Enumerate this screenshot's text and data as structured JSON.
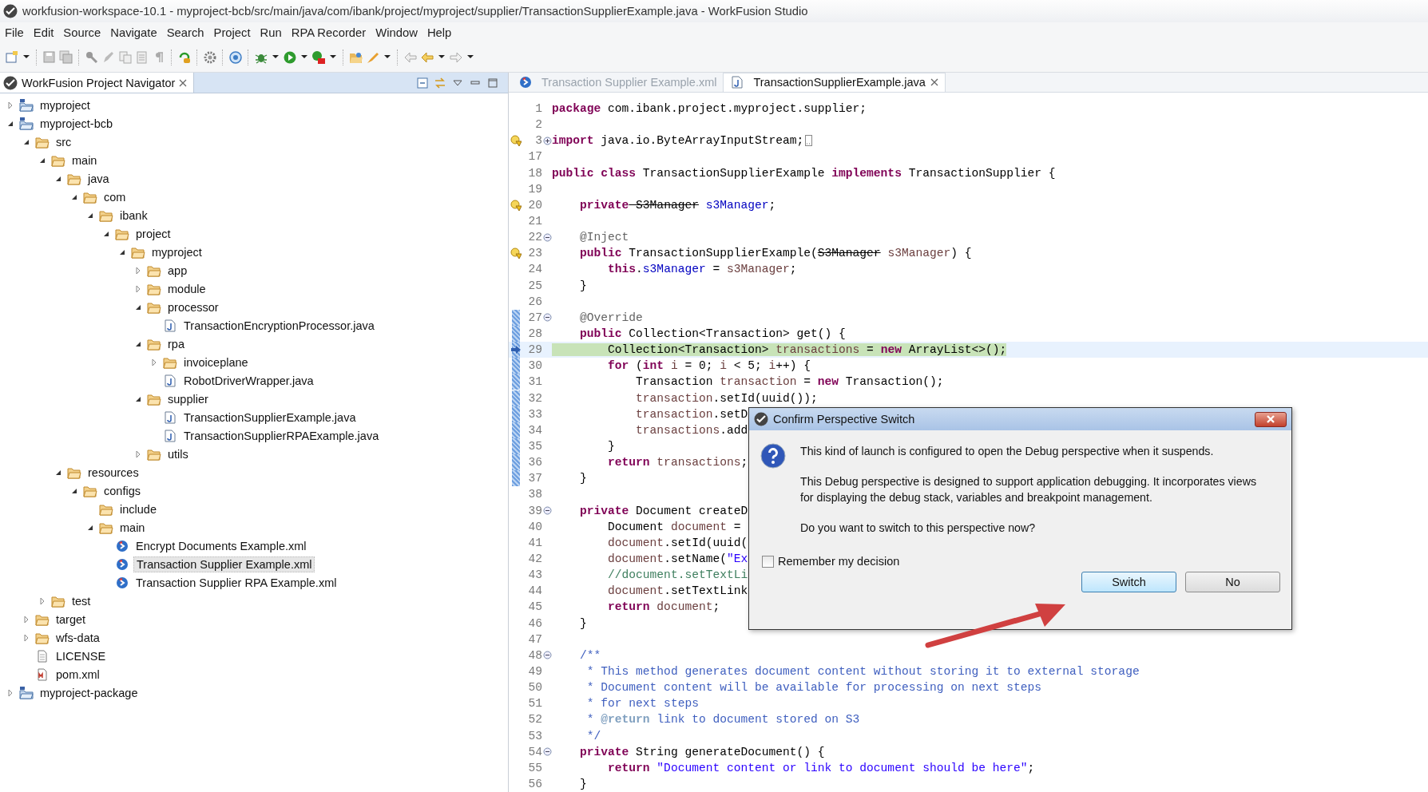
{
  "window": {
    "title": "workfusion-workspace-10.1 - myproject-bcb/src/main/java/com/ibank/project/myproject/supplier/TransactionSupplierExample.java - WorkFusion Studio"
  },
  "menu": [
    "File",
    "Edit",
    "Source",
    "Navigate",
    "Search",
    "Project",
    "Run",
    "RPA Recorder",
    "Window",
    "Help"
  ],
  "navigator": {
    "title": "WorkFusion Project Navigator",
    "tree": [
      {
        "label": "myproject",
        "kind": "project",
        "expanded": false,
        "selected": false
      },
      {
        "label": "myproject-bcb",
        "kind": "project",
        "expanded": true,
        "selected": false,
        "children": [
          {
            "label": "src",
            "kind": "folder",
            "expanded": true,
            "selected": false,
            "children": [
              {
                "label": "main",
                "kind": "folder",
                "expanded": true,
                "selected": false,
                "children": [
                  {
                    "label": "java",
                    "kind": "folder",
                    "expanded": true,
                    "selected": false,
                    "children": [
                      {
                        "label": "com",
                        "kind": "folder",
                        "expanded": true,
                        "selected": false,
                        "children": [
                          {
                            "label": "ibank",
                            "kind": "folder",
                            "expanded": true,
                            "selected": false,
                            "children": [
                              {
                                "label": "project",
                                "kind": "folder",
                                "expanded": true,
                                "selected": false,
                                "children": [
                                  {
                                    "label": "myproject",
                                    "kind": "folder",
                                    "expanded": true,
                                    "selected": false,
                                    "children": [
                                      {
                                        "label": "app",
                                        "kind": "folder",
                                        "expanded": false,
                                        "selected": false
                                      },
                                      {
                                        "label": "module",
                                        "kind": "folder",
                                        "expanded": false,
                                        "selected": false
                                      },
                                      {
                                        "label": "processor",
                                        "kind": "folder",
                                        "expanded": true,
                                        "selected": false,
                                        "children": [
                                          {
                                            "label": "TransactionEncryptionProcessor.java",
                                            "kind": "java",
                                            "selected": false
                                          }
                                        ]
                                      },
                                      {
                                        "label": "rpa",
                                        "kind": "folder",
                                        "expanded": true,
                                        "selected": false,
                                        "children": [
                                          {
                                            "label": "invoiceplane",
                                            "kind": "folder",
                                            "expanded": false,
                                            "selected": false
                                          },
                                          {
                                            "label": "RobotDriverWrapper.java",
                                            "kind": "java",
                                            "selected": false
                                          }
                                        ]
                                      },
                                      {
                                        "label": "supplier",
                                        "kind": "folder",
                                        "expanded": true,
                                        "selected": false,
                                        "children": [
                                          {
                                            "label": "TransactionSupplierExample.java",
                                            "kind": "java",
                                            "selected": false
                                          },
                                          {
                                            "label": "TransactionSupplierRPAExample.java",
                                            "kind": "java",
                                            "selected": false
                                          }
                                        ]
                                      },
                                      {
                                        "label": "utils",
                                        "kind": "folder",
                                        "expanded": false,
                                        "selected": false
                                      }
                                    ]
                                  }
                                ]
                              }
                            ]
                          }
                        ]
                      }
                    ]
                  },
                  {
                    "label": "resources",
                    "kind": "folder",
                    "expanded": true,
                    "selected": false,
                    "children": [
                      {
                        "label": "configs",
                        "kind": "folder",
                        "expanded": true,
                        "selected": false,
                        "children": [
                          {
                            "label": "include",
                            "kind": "folder",
                            "selected": false
                          },
                          {
                            "label": "main",
                            "kind": "folder",
                            "expanded": true,
                            "selected": false,
                            "children": [
                              {
                                "label": "Encrypt Documents Example.xml",
                                "kind": "xml",
                                "selected": false
                              },
                              {
                                "label": "Transaction Supplier Example.xml",
                                "kind": "xml",
                                "selected": true
                              },
                              {
                                "label": "Transaction Supplier RPA Example.xml",
                                "kind": "xml",
                                "selected": false
                              }
                            ]
                          }
                        ]
                      }
                    ]
                  }
                ]
              },
              {
                "label": "test",
                "kind": "folder",
                "expanded": false,
                "selected": false
              }
            ]
          },
          {
            "label": "target",
            "kind": "folder",
            "expanded": false,
            "selected": false
          },
          {
            "label": "wfs-data",
            "kind": "folder",
            "expanded": false,
            "selected": false
          },
          {
            "label": "LICENSE",
            "kind": "file",
            "selected": false
          },
          {
            "label": "pom.xml",
            "kind": "pom",
            "selected": false
          }
        ]
      },
      {
        "label": "myproject-package",
        "kind": "project",
        "expanded": false,
        "selected": false
      }
    ]
  },
  "editor": {
    "tabs": [
      {
        "label": "Transaction Supplier Example.xml",
        "kind": "xml",
        "selected": false
      },
      {
        "label": "TransactionSupplierExample.java",
        "kind": "java",
        "selected": true
      }
    ],
    "lines": [
      {
        "n": "1",
        "current": false,
        "ranged": false,
        "tokens": [
          {
            "kind": "kw",
            "text": "package"
          },
          {
            "kind": "plain",
            "text": " com.ibank.project.myproject.supplier;"
          }
        ]
      },
      {
        "n": "2",
        "current": false,
        "ranged": false
      },
      {
        "n": "3",
        "current": false,
        "ranged": false,
        "warning": true,
        "collapsed": true,
        "tokens": [
          {
            "kind": "kw",
            "text": "import"
          },
          {
            "kind": "plain",
            "text": " java.io.ByteArrayInputStream;"
          }
        ]
      },
      {
        "n": "17",
        "current": false,
        "ranged": false
      },
      {
        "n": "18",
        "current": false,
        "ranged": false,
        "tokens": [
          {
            "kind": "kw",
            "text": "public class"
          },
          {
            "kind": "plain",
            "text": " TransactionSupplierExample "
          },
          {
            "kind": "kw",
            "text": "implements"
          },
          {
            "kind": "plain",
            "text": " TransactionSupplier {"
          }
        ]
      },
      {
        "n": "19",
        "current": false,
        "ranged": false
      },
      {
        "n": "20",
        "current": false,
        "ranged": false,
        "warning": true,
        "tokens": [
          {
            "kind": "kw",
            "text": "    private"
          },
          {
            "kind": "dep",
            "text": " S3Manager"
          },
          {
            "kind": "field",
            "text": " s3Manager"
          },
          {
            "kind": "plain",
            "text": ";"
          }
        ]
      },
      {
        "n": "21",
        "current": false,
        "ranged": false
      },
      {
        "n": "22",
        "current": false,
        "ranged": false,
        "collapsed": false,
        "tokens": [
          {
            "kind": "ann",
            "text": "    @Inject"
          }
        ]
      },
      {
        "n": "23",
        "current": false,
        "ranged": false,
        "warning": true,
        "tokens": [
          {
            "kind": "kw",
            "text": "    public"
          },
          {
            "kind": "plain",
            "text": " TransactionSupplierExample("
          },
          {
            "kind": "dep",
            "text": "S3Manager"
          },
          {
            "kind": "local",
            "text": " s3Manager"
          },
          {
            "kind": "plain",
            "text": ") {"
          }
        ]
      },
      {
        "n": "24",
        "current": false,
        "ranged": false,
        "tokens": [
          {
            "kind": "kw",
            "text": "        this"
          },
          {
            "kind": "plain",
            "text": "."
          },
          {
            "kind": "field",
            "text": "s3Manager"
          },
          {
            "kind": "plain",
            "text": " = "
          },
          {
            "kind": "local",
            "text": "s3Manager"
          },
          {
            "kind": "plain",
            "text": ";"
          }
        ]
      },
      {
        "n": "25",
        "current": false,
        "ranged": false,
        "tokens": [
          {
            "kind": "plain",
            "text": "    }"
          }
        ]
      },
      {
        "n": "26",
        "current": false,
        "ranged": false
      },
      {
        "n": "27",
        "current": false,
        "ranged": true,
        "collapsed": false,
        "tokens": [
          {
            "kind": "ann",
            "text": "    @Override"
          }
        ]
      },
      {
        "n": "28",
        "current": false,
        "ranged": true,
        "tokens": [
          {
            "kind": "kw",
            "text": "    public"
          },
          {
            "kind": "plain",
            "text": " Collection<Transaction> get() {"
          }
        ]
      },
      {
        "n": "29",
        "current": true,
        "ranged": true,
        "tokens": [
          {
            "kind": "plain",
            "text": "        Collection<Transaction> "
          },
          {
            "kind": "local",
            "text": "transactions"
          },
          {
            "kind": "plain",
            "text": " = "
          },
          {
            "kind": "kw",
            "text": "new"
          },
          {
            "kind": "plain",
            "text": " ArrayList<>();"
          }
        ]
      },
      {
        "n": "30",
        "current": false,
        "ranged": true,
        "tokens": [
          {
            "kind": "kw",
            "text": "        for"
          },
          {
            "kind": "plain",
            "text": " ("
          },
          {
            "kind": "kw",
            "text": "int"
          },
          {
            "kind": "local",
            "text": " i"
          },
          {
            "kind": "plain",
            "text": " = 0; "
          },
          {
            "kind": "local",
            "text": "i"
          },
          {
            "kind": "plain",
            "text": " < 5; "
          },
          {
            "kind": "local",
            "text": "i"
          },
          {
            "kind": "plain",
            "text": "++) {"
          }
        ]
      },
      {
        "n": "31",
        "current": false,
        "ranged": true,
        "tokens": [
          {
            "kind": "plain",
            "text": "            Transaction "
          },
          {
            "kind": "local",
            "text": "transaction"
          },
          {
            "kind": "plain",
            "text": " = "
          },
          {
            "kind": "kw",
            "text": "new"
          },
          {
            "kind": "plain",
            "text": " Transaction();"
          }
        ]
      },
      {
        "n": "32",
        "current": false,
        "ranged": true,
        "tokens": [
          {
            "kind": "local",
            "text": "            transaction"
          },
          {
            "kind": "plain",
            "text": ".setId(uuid());"
          }
        ]
      },
      {
        "n": "33",
        "current": false,
        "ranged": true,
        "tokens": [
          {
            "kind": "local",
            "text": "            transaction"
          },
          {
            "kind": "plain",
            "text": ".setD"
          }
        ]
      },
      {
        "n": "34",
        "current": false,
        "ranged": true,
        "tokens": [
          {
            "kind": "local",
            "text": "            transactions"
          },
          {
            "kind": "plain",
            "text": ".add"
          }
        ]
      },
      {
        "n": "35",
        "current": false,
        "ranged": true,
        "tokens": [
          {
            "kind": "plain",
            "text": "        }"
          }
        ]
      },
      {
        "n": "36",
        "current": false,
        "ranged": true,
        "tokens": [
          {
            "kind": "kw",
            "text": "        return"
          },
          {
            "kind": "local",
            "text": " transactions"
          },
          {
            "kind": "plain",
            "text": ";"
          }
        ]
      },
      {
        "n": "37",
        "current": false,
        "ranged": true,
        "tokens": [
          {
            "kind": "plain",
            "text": "    }"
          }
        ]
      },
      {
        "n": "38",
        "current": false,
        "ranged": false
      },
      {
        "n": "39",
        "current": false,
        "ranged": false,
        "collapsed": false,
        "tokens": [
          {
            "kind": "kw",
            "text": "    private"
          },
          {
            "kind": "plain",
            "text": " Document createD"
          }
        ]
      },
      {
        "n": "40",
        "current": false,
        "ranged": false,
        "tokens": [
          {
            "kind": "plain",
            "text": "        Document "
          },
          {
            "kind": "local",
            "text": "document"
          },
          {
            "kind": "plain",
            "text": " ="
          }
        ]
      },
      {
        "n": "41",
        "current": false,
        "ranged": false,
        "tokens": [
          {
            "kind": "local",
            "text": "        document"
          },
          {
            "kind": "plain",
            "text": ".setId(uuid("
          }
        ]
      },
      {
        "n": "42",
        "current": false,
        "ranged": false,
        "tokens": [
          {
            "kind": "local",
            "text": "        document"
          },
          {
            "kind": "plain",
            "text": ".setName("
          },
          {
            "kind": "str",
            "text": "\"Ex"
          }
        ]
      },
      {
        "n": "43",
        "current": false,
        "ranged": false,
        "tokens": [
          {
            "kind": "comment",
            "text": "        //document.setTextLi"
          }
        ]
      },
      {
        "n": "44",
        "current": false,
        "ranged": false,
        "tokens": [
          {
            "kind": "local",
            "text": "        document"
          },
          {
            "kind": "plain",
            "text": ".setTextLink"
          }
        ]
      },
      {
        "n": "45",
        "current": false,
        "ranged": false,
        "tokens": [
          {
            "kind": "kw",
            "text": "        return"
          },
          {
            "kind": "local",
            "text": " document"
          },
          {
            "kind": "plain",
            "text": ";"
          }
        ]
      },
      {
        "n": "46",
        "current": false,
        "ranged": false,
        "tokens": [
          {
            "kind": "plain",
            "text": "    }"
          }
        ]
      },
      {
        "n": "47",
        "current": false,
        "ranged": false
      },
      {
        "n": "48",
        "current": false,
        "ranged": false,
        "collapsed": false,
        "tokens": [
          {
            "kind": "javadoc",
            "text": "    /**"
          }
        ]
      },
      {
        "n": "49",
        "current": false,
        "ranged": false,
        "tokens": [
          {
            "kind": "javadoc",
            "text": "     * This method generates document content without storing it to external storage"
          }
        ]
      },
      {
        "n": "50",
        "current": false,
        "ranged": false,
        "tokens": [
          {
            "kind": "javadoc",
            "text": "     * Document content will be available for processing on next steps"
          }
        ]
      },
      {
        "n": "51",
        "current": false,
        "ranged": false,
        "tokens": [
          {
            "kind": "javadoc",
            "text": "     * for next steps"
          }
        ]
      },
      {
        "n": "52",
        "current": false,
        "ranged": false,
        "tokens": [
          {
            "kind": "javadoc",
            "text": "     * "
          },
          {
            "kind": "javadoc_tag",
            "text": "@return"
          },
          {
            "kind": "javadoc",
            "text": " link to document stored on S3"
          }
        ]
      },
      {
        "n": "53",
        "current": false,
        "ranged": false,
        "tokens": [
          {
            "kind": "javadoc",
            "text": "     */"
          }
        ]
      },
      {
        "n": "54",
        "current": false,
        "ranged": false,
        "collapsed": false,
        "tokens": [
          {
            "kind": "kw",
            "text": "    private"
          },
          {
            "kind": "plain",
            "text": " String generateDocument() {"
          }
        ]
      },
      {
        "n": "55",
        "current": false,
        "ranged": false,
        "tokens": [
          {
            "kind": "kw",
            "text": "        return"
          },
          {
            "kind": "str",
            "text": " \"Document content or link to document should be here\""
          },
          {
            "kind": "plain",
            "text": ";"
          }
        ]
      },
      {
        "n": "56",
        "current": false,
        "ranged": false,
        "tokens": [
          {
            "kind": "plain",
            "text": "    }"
          }
        ]
      }
    ]
  },
  "dialog": {
    "title": "Confirm Perspective Switch",
    "paragraphs": [
      "This kind of launch is configured to open the Debug perspective when it suspends.",
      "This Debug perspective is designed to support application debugging.  It incorporates views for displaying the debug stack, variables and breakpoint management.",
      "Do you want to switch to this perspective now?"
    ],
    "checkbox": {
      "label": "Remember my decision",
      "checked": false
    },
    "buttons": [
      {
        "label": "Switch",
        "default": true
      },
      {
        "label": "No",
        "default": false
      }
    ]
  }
}
